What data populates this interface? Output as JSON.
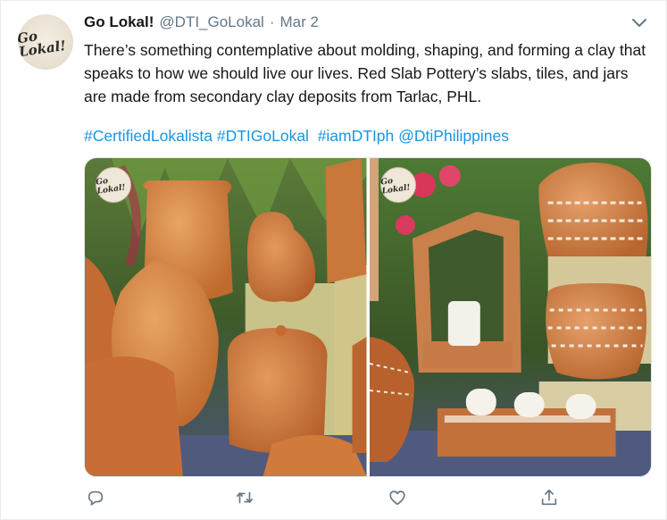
{
  "tweet": {
    "author_name": "Go Lokal!",
    "handle": "@DTI_GoLokal",
    "separator": "·",
    "date": "Mar 2",
    "text": "There’s something contemplative about molding, shaping, and forming a clay that speaks to how we should live our lives. Red Slab Pottery’s slabs, tiles, and jars are made from secondary clay deposits from Tarlac, PHL.",
    "hashtags": [
      "#CertifiedLokalista",
      "#DTIGoLokal",
      "#iamDTIph",
      "@DtiPhilippines"
    ],
    "avatar_logo_text": "Go Lokal!",
    "media_watermark_text": "Go Lokal!"
  },
  "actions": [
    {
      "name": "reply",
      "icon": "reply-icon"
    },
    {
      "name": "retweet",
      "icon": "retweet-icon"
    },
    {
      "name": "like",
      "icon": "heart-icon"
    },
    {
      "name": "share",
      "icon": "share-icon"
    }
  ],
  "colors": {
    "link": "#1b95e0",
    "secondary_text": "#657786",
    "primary_text": "#14171a",
    "terracotta": "#c46a33"
  }
}
